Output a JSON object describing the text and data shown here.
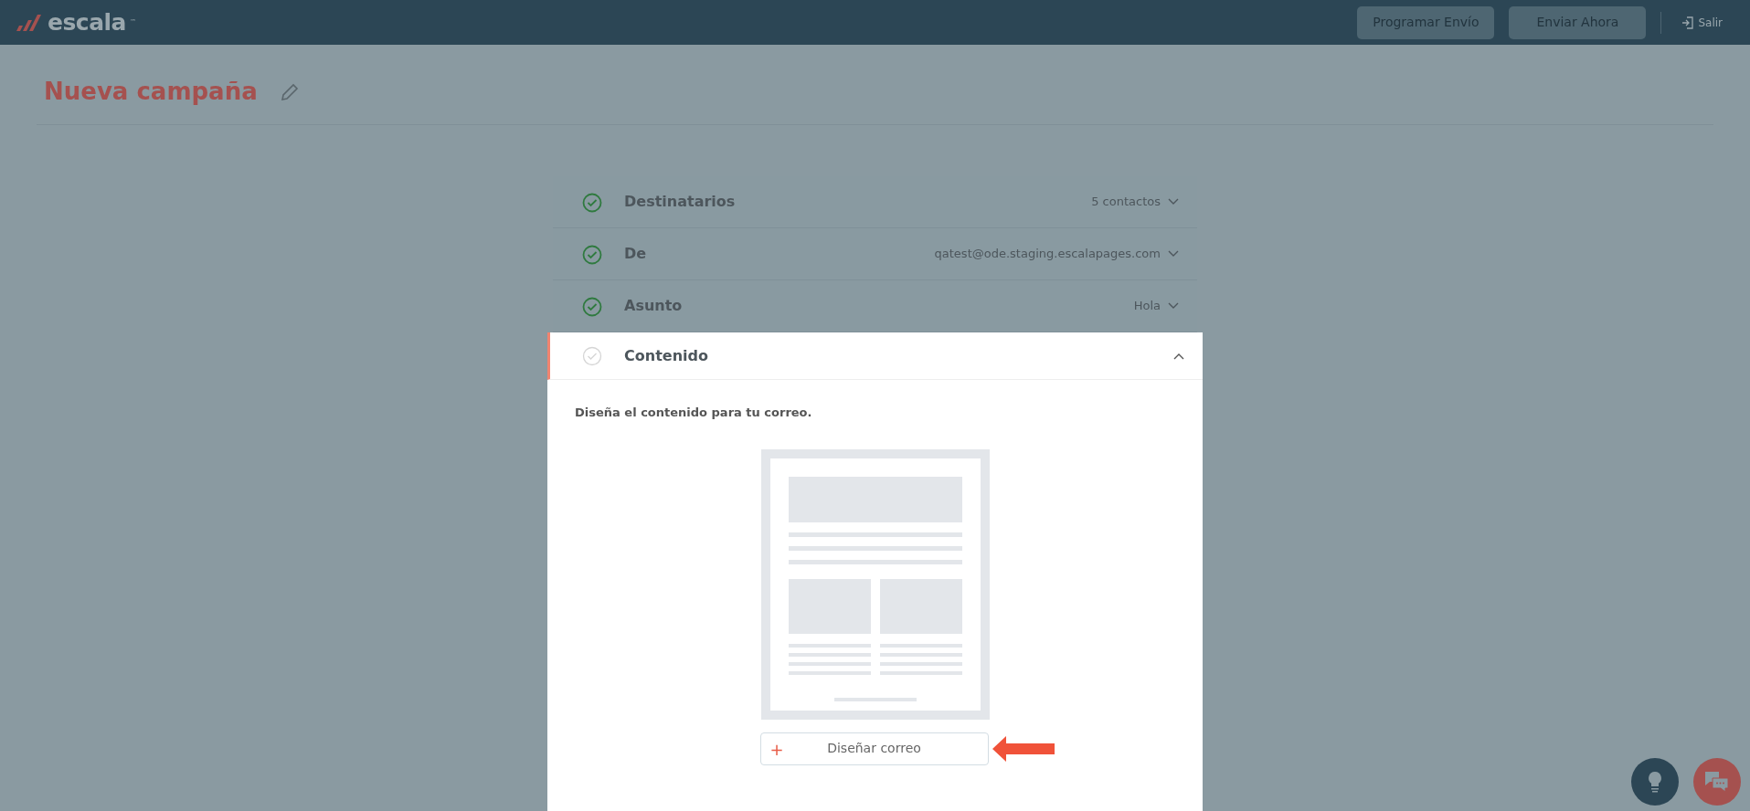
{
  "navbar": {
    "logo": "escala",
    "logo_mark": "™",
    "buttons": [
      {
        "label": "Programar Envío",
        "disabled": true
      },
      {
        "label": "Enviar Ahora",
        "disabled": true
      }
    ],
    "logout": "Salir"
  },
  "page_title": "Nueva campaña",
  "sections": [
    {
      "title": "Destinatarios",
      "summary": "5 contactos",
      "done": true,
      "expanded": false
    },
    {
      "title": "De",
      "summary": "qatest@ode.staging.escalapages.com",
      "done": true,
      "expanded": false
    },
    {
      "title": "Asunto",
      "summary": "Hola",
      "done": true,
      "expanded": false
    },
    {
      "title": "Contenido",
      "done": false,
      "expanded": true,
      "description": "Diseña el contenido para tu correo.",
      "action": {
        "icon": "+",
        "label": "Diseñar correo"
      }
    }
  ]
}
